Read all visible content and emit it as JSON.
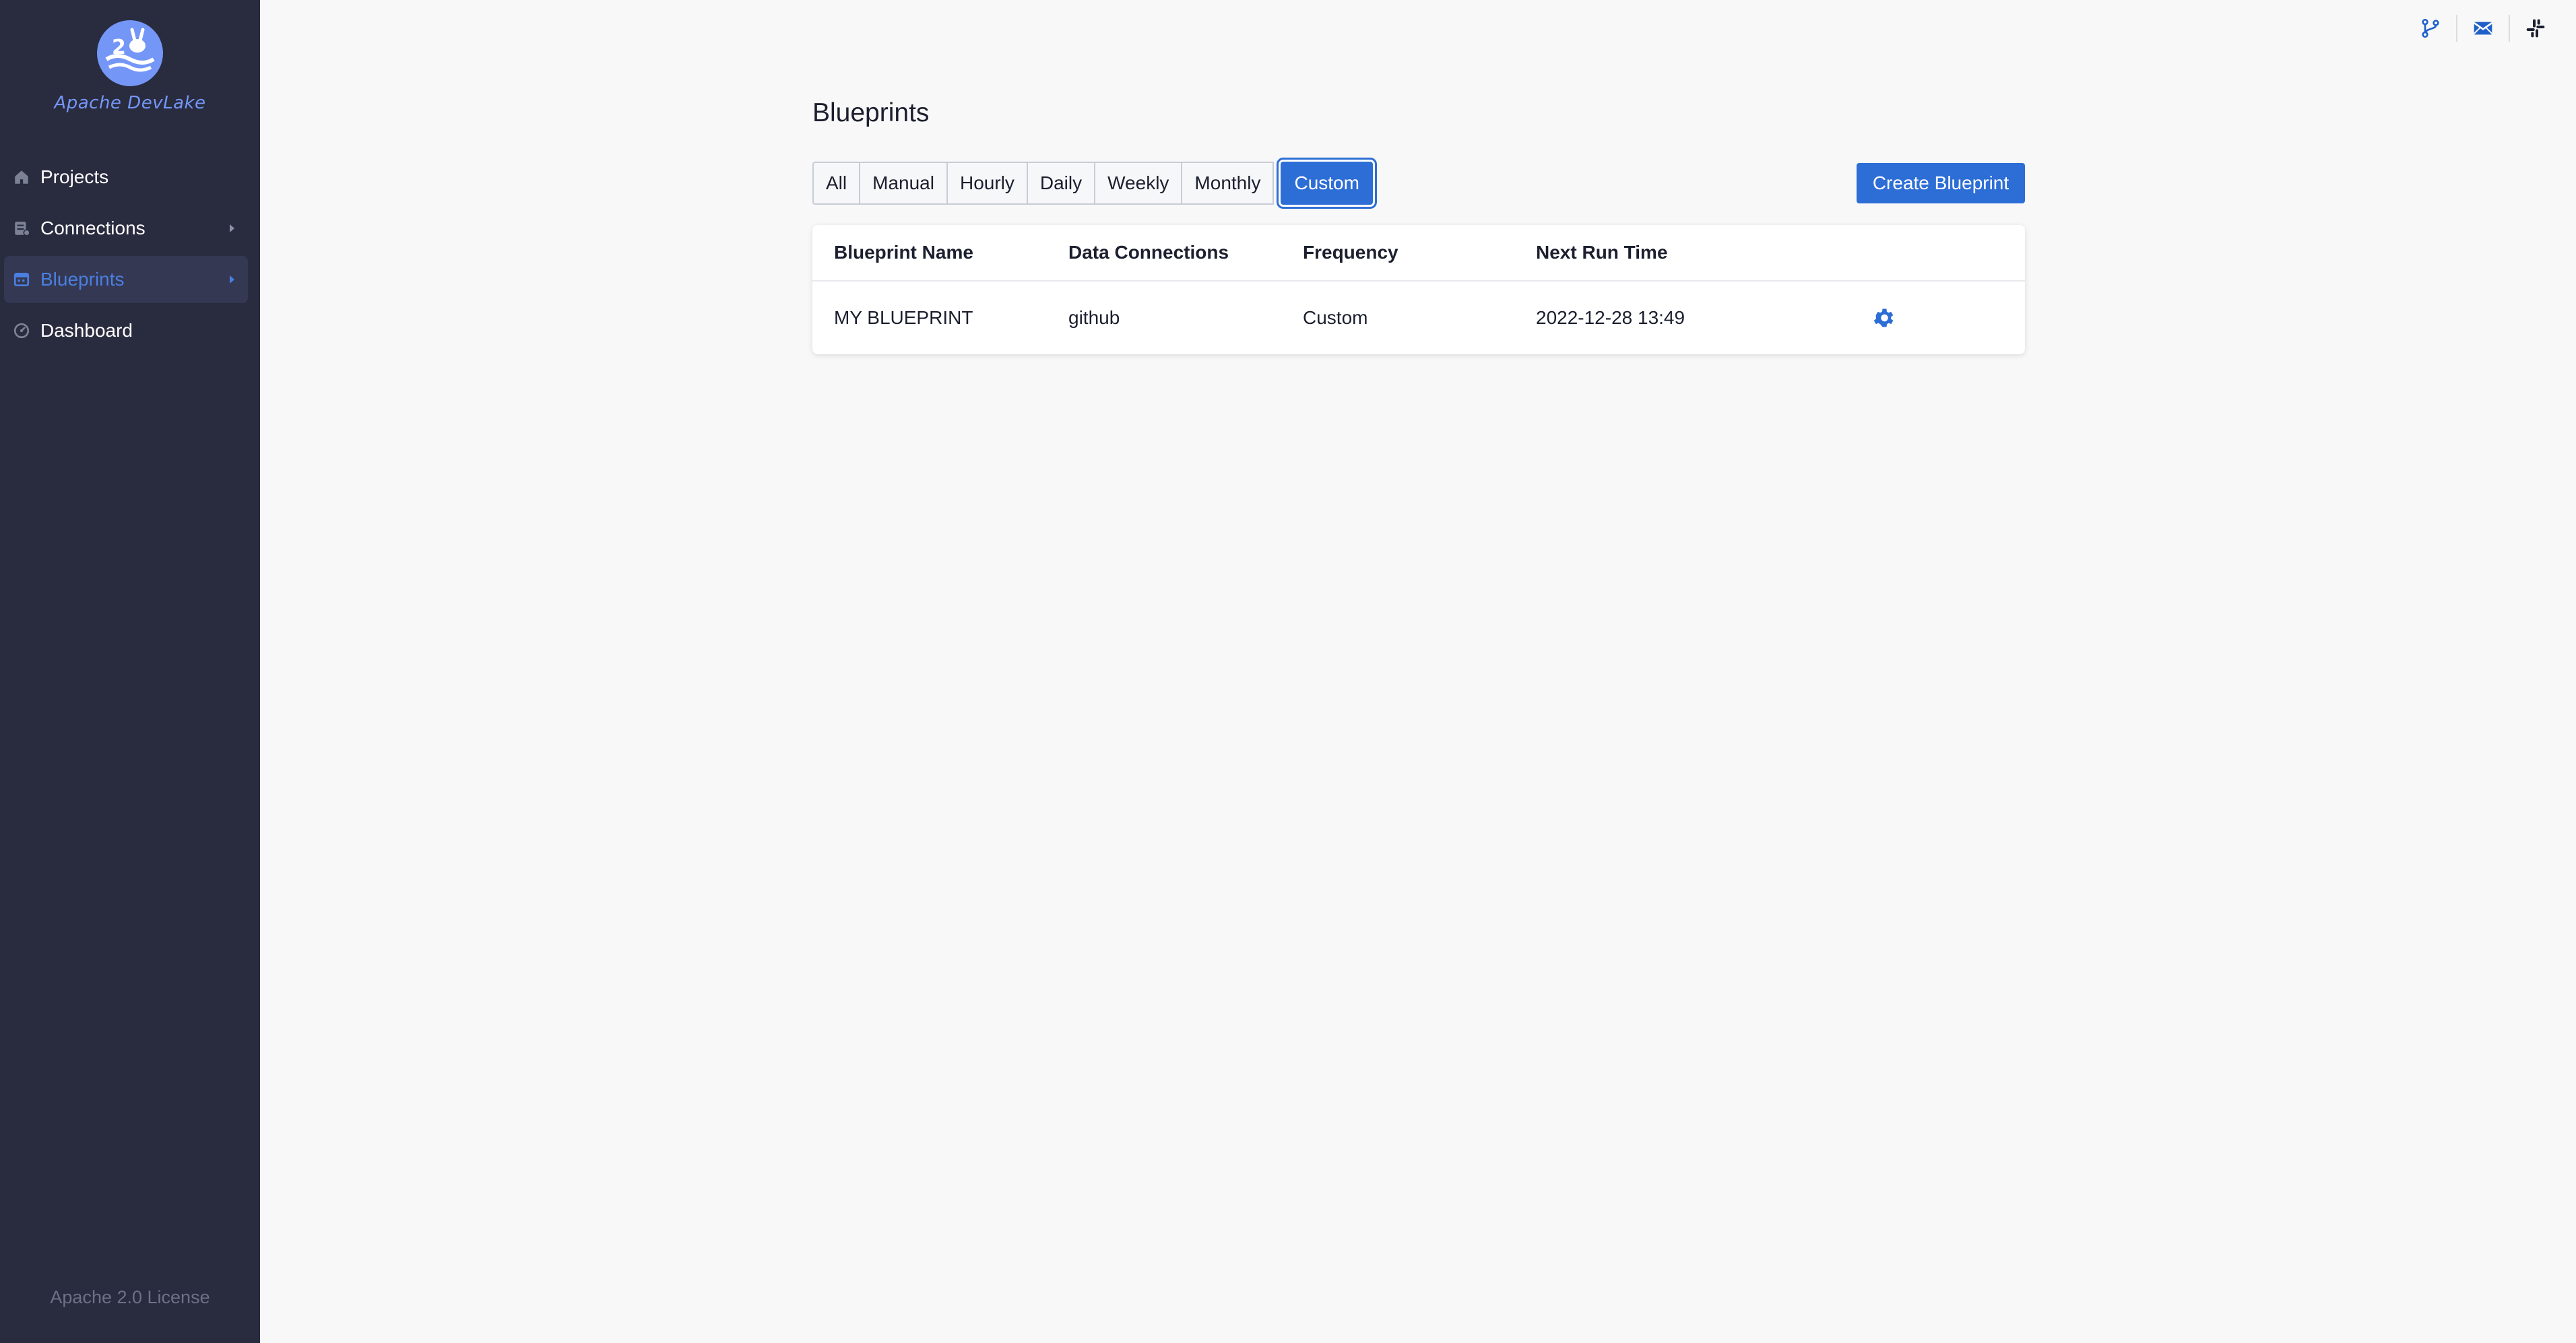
{
  "sidebar": {
    "logo_text": "Apache DevLake",
    "items": [
      {
        "label": "Projects",
        "icon": "home-icon",
        "active": false,
        "has_caret": false
      },
      {
        "label": "Connections",
        "icon": "connections-icon",
        "active": false,
        "has_caret": true
      },
      {
        "label": "Blueprints",
        "icon": "blueprints-icon",
        "active": true,
        "has_caret": true
      },
      {
        "label": "Dashboard",
        "icon": "dashboard-icon",
        "active": false,
        "has_caret": false
      }
    ],
    "license": "Apache 2.0 License"
  },
  "topbar": {
    "icons": [
      "git-branch-icon",
      "mail-icon",
      "slack-icon"
    ]
  },
  "page": {
    "title": "Blueprints",
    "filters": [
      "All",
      "Manual",
      "Hourly",
      "Daily",
      "Weekly",
      "Monthly",
      "Custom"
    ],
    "selected_filter": "Custom",
    "create_label": "Create Blueprint"
  },
  "table": {
    "headers": [
      "Blueprint Name",
      "Data Connections",
      "Frequency",
      "Next Run Time"
    ],
    "rows": [
      {
        "name": "MY BLUEPRINT",
        "connections": "github",
        "frequency": "Custom",
        "next_run": "2022-12-28 13:49",
        "action_icon": "gear-icon"
      }
    ]
  },
  "colors": {
    "sidebar_bg": "#292b3f",
    "accent": "#2d6ed6",
    "page_bg": "#f8f8f8"
  }
}
